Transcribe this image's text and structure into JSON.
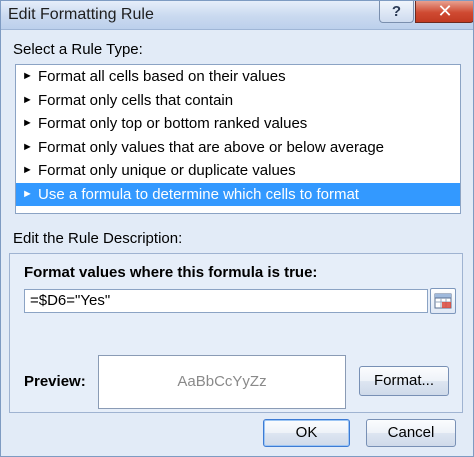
{
  "window": {
    "title": "Edit Formatting Rule",
    "help_label": "?",
    "close_label": "✕"
  },
  "rule_type": {
    "label": "Select a Rule Type:",
    "arrow": "►",
    "items": [
      {
        "label": "Format all cells based on their values",
        "selected": false
      },
      {
        "label": "Format only cells that contain",
        "selected": false
      },
      {
        "label": "Format only top or bottom ranked values",
        "selected": false
      },
      {
        "label": "Format only values that are above or below average",
        "selected": false
      },
      {
        "label": "Format only unique or duplicate values",
        "selected": false
      },
      {
        "label": "Use a formula to determine which cells to format",
        "selected": true
      }
    ]
  },
  "description": {
    "label": "Edit the Rule Description:",
    "formula_header": "Format values where this formula is true:",
    "formula_value": "=$D6=\"Yes\"",
    "collapse_icon": "range-select-icon",
    "preview_label": "Preview:",
    "preview_text": "AaBbCcYyZz",
    "format_button": "Format..."
  },
  "footer": {
    "ok_label": "OK",
    "cancel_label": "Cancel"
  }
}
